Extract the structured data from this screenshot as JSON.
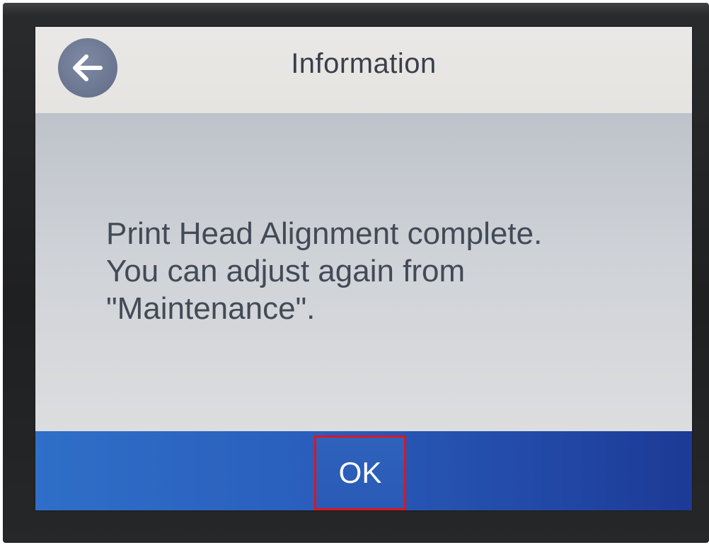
{
  "header": {
    "title": "Information",
    "back_icon": "back-arrow-icon"
  },
  "message": {
    "lines": [
      "Print Head Alignment complete.",
      "You can adjust again from",
      "\"Maintenance\"."
    ]
  },
  "footer": {
    "ok_label": "OK",
    "highlight_color": "#e0141e"
  },
  "colors": {
    "header_bg": "#e7e6e3",
    "content_bg": "#c9ccd3",
    "footer_bg": "#2a5fbd",
    "back_button_bg": "#6c7791"
  }
}
